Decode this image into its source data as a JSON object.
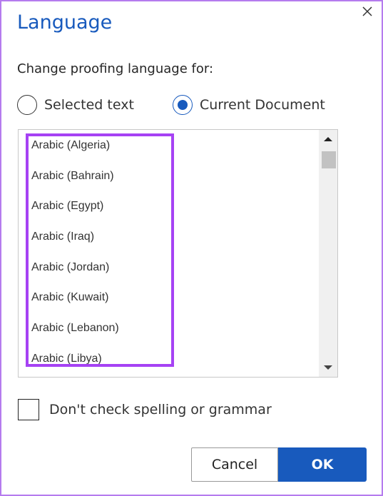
{
  "dialog": {
    "title": "Language",
    "subtitle": "Change proofing language for:",
    "close_icon": "close-icon"
  },
  "scope": {
    "options": [
      {
        "label": "Selected text",
        "selected": false
      },
      {
        "label": "Current Document",
        "selected": true
      }
    ]
  },
  "languages": [
    "Arabic (Algeria)",
    "Arabic (Bahrain)",
    "Arabic (Egypt)",
    "Arabic (Iraq)",
    "Arabic (Jordan)",
    "Arabic (Kuwait)",
    "Arabic (Lebanon)",
    "Arabic (Libya)"
  ],
  "options": {
    "dont_check_label": "Don't check spelling or grammar",
    "dont_check_checked": false
  },
  "buttons": {
    "cancel": "Cancel",
    "ok": "OK"
  },
  "colors": {
    "accent": "#185abd",
    "highlight": "#a642f4"
  }
}
